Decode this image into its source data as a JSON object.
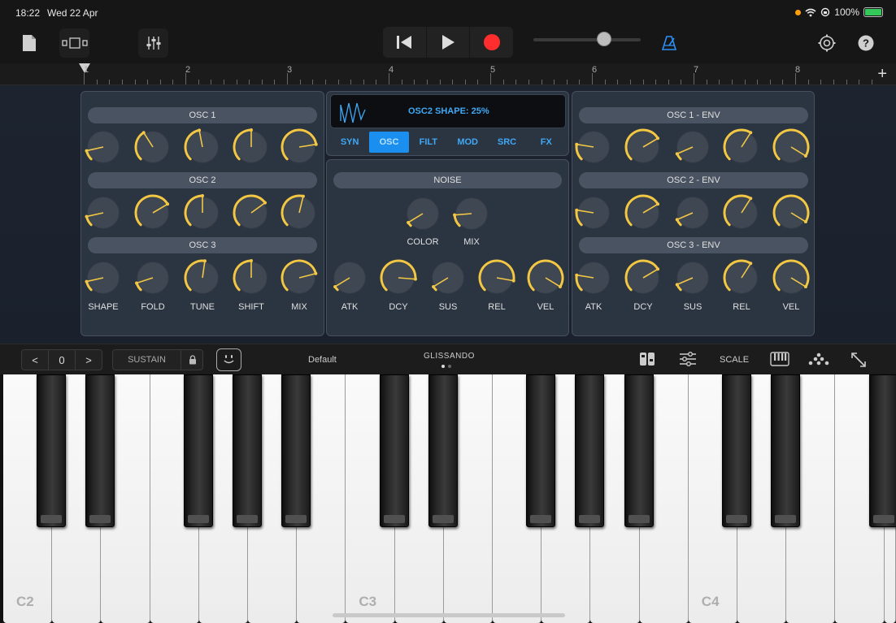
{
  "status": {
    "time": "18:22",
    "date": "Wed 22 Apr",
    "battery": "100%"
  },
  "ruler": {
    "bars": [
      "1",
      "2",
      "3",
      "4",
      "5",
      "6",
      "7",
      "8"
    ]
  },
  "display": {
    "text": "OSC2 SHAPE: 25%"
  },
  "tabs": [
    {
      "label": "SYN",
      "active": false
    },
    {
      "label": "OSC",
      "active": true
    },
    {
      "label": "FILT",
      "active": false
    },
    {
      "label": "MOD",
      "active": false
    },
    {
      "label": "SRC",
      "active": false
    },
    {
      "label": "FX",
      "active": false
    }
  ],
  "left_panel": {
    "sections": [
      "OSC 1",
      "OSC 2",
      "OSC 3"
    ],
    "labels": [
      "SHAPE",
      "FOLD",
      "TUNE",
      "SHIFT",
      "MIX"
    ]
  },
  "noise_panel": {
    "title": "NOISE",
    "top_labels": [
      "COLOR",
      "MIX"
    ],
    "env_labels": [
      "ATK",
      "DCY",
      "SUS",
      "REL",
      "VEL"
    ]
  },
  "right_panel": {
    "sections": [
      "OSC 1 - ENV",
      "OSC 2 - ENV",
      "OSC 3 - ENV"
    ],
    "labels": [
      "ATK",
      "DCY",
      "SUS",
      "REL",
      "VEL"
    ]
  },
  "knobs": {
    "osc1": [
      0.12,
      0.38,
      0.46,
      0.5,
      0.8
    ],
    "osc2": [
      0.12,
      0.72,
      0.5,
      0.7,
      0.55
    ],
    "osc3": [
      0.12,
      0.1,
      0.53,
      0.5,
      0.78
    ],
    "noise_top": [
      0.05,
      0.15
    ],
    "noise_env": [
      0.05,
      0.85,
      0.05,
      0.87,
      0.95
    ],
    "env1": [
      0.2,
      0.72,
      0.08,
      0.62,
      0.95
    ],
    "env2": [
      0.2,
      0.72,
      0.08,
      0.62,
      0.95
    ],
    "env3": [
      0.2,
      0.72,
      0.08,
      0.62,
      0.95
    ]
  },
  "accent_color": "#f2c744",
  "keyboard_controls": {
    "octave_prev": "<",
    "octave_value": "0",
    "octave_next": ">",
    "sustain": "SUSTAIN",
    "preset": "Default",
    "glissando": "GLISSANDO",
    "scale": "SCALE"
  },
  "keys": {
    "labels": [
      "C2",
      "C3",
      "C4"
    ]
  },
  "icons": [
    "document-icon",
    "tracks-view-icon",
    "mixer-icon",
    "rewind-icon",
    "play-icon",
    "record-icon",
    "metronome-icon",
    "settings-icon",
    "help-icon",
    "lock-icon",
    "smiley-icon",
    "split-view-icon",
    "sliders-icon",
    "keyboard-icon",
    "arpeggiator-icon",
    "expand-icon"
  ]
}
